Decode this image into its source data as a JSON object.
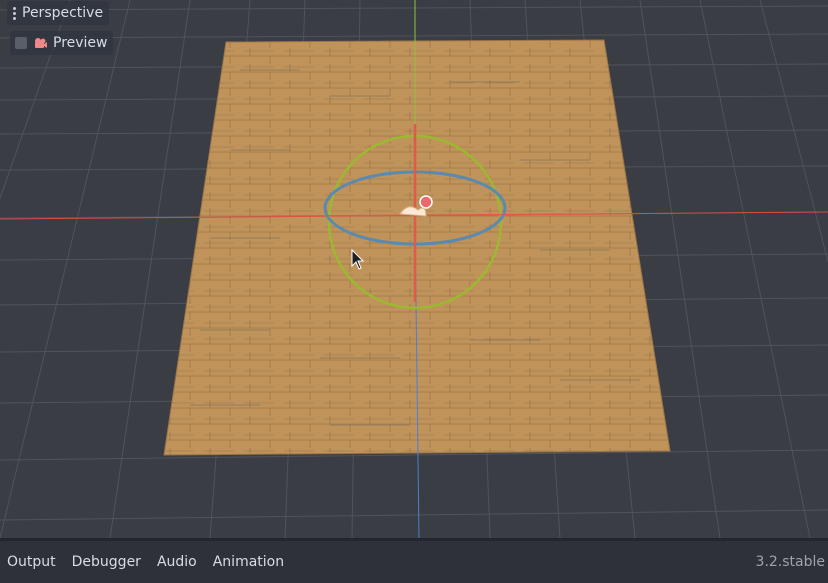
{
  "viewport": {
    "perspective_label": "Perspective",
    "preview_label": "Preview",
    "preview_checked": false
  },
  "bottom_panel": {
    "tabs": [
      {
        "label": "Output"
      },
      {
        "label": "Debugger"
      },
      {
        "label": "Audio"
      },
      {
        "label": "Animation"
      }
    ],
    "version": "3.2.stable"
  },
  "colors": {
    "viewport_background": "#3a3d44",
    "grid_line": "#50545c",
    "floor_fill": "#c0935a",
    "x_axis": "#d94a4a",
    "y_axis": "#8ac23a",
    "z_axis": "#4a7fd4",
    "gizmo_ring_y": "#9cb832",
    "gizmo_ring_x": "#5b8ab0",
    "gizmo_axis_red": "#e05a4a"
  }
}
